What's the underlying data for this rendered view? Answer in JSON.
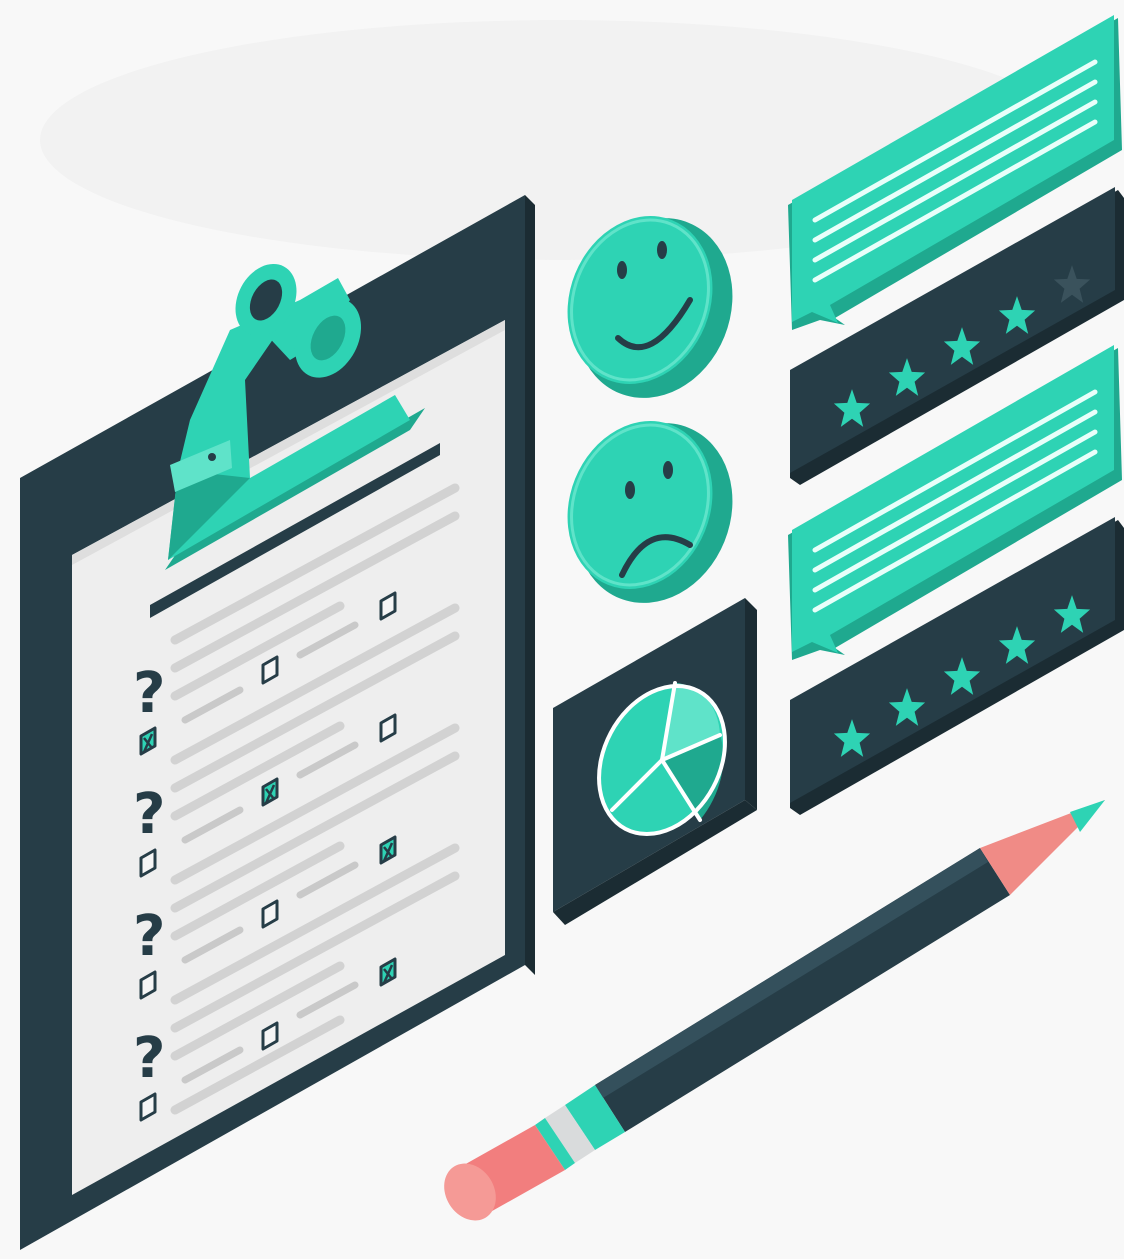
{
  "title": "",
  "colors": {
    "background": "#f8f8f8",
    "teal": "#2ed3b4",
    "teal_dark": "#1fa98f",
    "teal_light": "#5fe3c9",
    "navy": "#263d47",
    "navy_dark": "#1b2c33",
    "paper": "#eeeeee",
    "paper_line": "#d4d4d4",
    "pencil_tip": "#f08b86",
    "eraser": "#f27e7e",
    "metal": "#d9dbdc"
  },
  "icons": [
    "clipboard-icon",
    "smiley-face-icon",
    "sad-face-icon",
    "pie-chart-icon",
    "speech-bubble-icon",
    "star-icon",
    "pencil-icon",
    "question-mark-icon",
    "checkbox-icon"
  ],
  "checklist": {
    "question_mark": "?",
    "questions": [
      {
        "checked": [
          true,
          false,
          false
        ]
      },
      {
        "checked": [
          false,
          true,
          false
        ]
      },
      {
        "checked": [
          false,
          false,
          true
        ]
      },
      {
        "checked": [
          false,
          false,
          true
        ]
      }
    ]
  },
  "ratings": [
    {
      "stars_filled": 4,
      "stars_total": 5
    },
    {
      "stars_filled": 5,
      "stars_total": 5
    }
  ],
  "feedback_faces": [
    "happy",
    "sad"
  ]
}
